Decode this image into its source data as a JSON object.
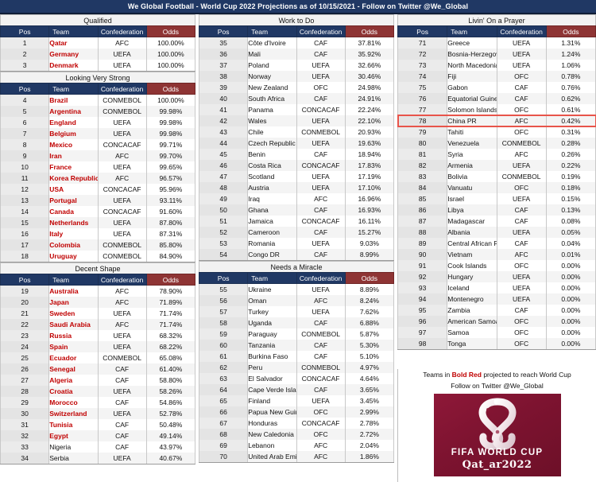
{
  "title": "We Global Football - World Cup 2022 Projections as of 10/15/2021 - Follow on Twitter @We_Global",
  "columns": {
    "pos": "Pos",
    "team": "Team",
    "confederation": "Confederation",
    "odds": "Odds"
  },
  "colors": {
    "header_navy": "#203864",
    "odds_header_red": "#8e3434",
    "qualified_red": "#c00000",
    "highlight": "#e8544a",
    "logo_maroon": "#7d1330"
  },
  "footer": {
    "note_pre": "Teams in ",
    "note_bold": "Bold Red",
    "note_post": " projected to reach World Cup",
    "twitter": "Follow on Twitter @We_Global",
    "logo_line1": "FIFA WORLD CUP",
    "logo_line2": "Qat_ar2022"
  },
  "sections": [
    {
      "name": "Qualified",
      "column": 1,
      "rows": [
        {
          "pos": "1",
          "team": "Qatar",
          "conf": "AFC",
          "odds": "100.00%",
          "qualified": true
        },
        {
          "pos": "2",
          "team": "Germany",
          "conf": "UEFA",
          "odds": "100.00%",
          "qualified": true
        },
        {
          "pos": "3",
          "team": "Denmark",
          "conf": "UEFA",
          "odds": "100.00%",
          "qualified": true
        }
      ]
    },
    {
      "name": "Looking Very Strong",
      "column": 1,
      "rows": [
        {
          "pos": "4",
          "team": "Brazil",
          "conf": "CONMEBOL",
          "odds": "100.00%",
          "qualified": true
        },
        {
          "pos": "5",
          "team": "Argentina",
          "conf": "CONMEBOL",
          "odds": "99.98%",
          "qualified": true
        },
        {
          "pos": "6",
          "team": "England",
          "conf": "UEFA",
          "odds": "99.98%",
          "qualified": true
        },
        {
          "pos": "7",
          "team": "Belgium",
          "conf": "UEFA",
          "odds": "99.98%",
          "qualified": true
        },
        {
          "pos": "8",
          "team": "Mexico",
          "conf": "CONCACAF",
          "odds": "99.71%",
          "qualified": true
        },
        {
          "pos": "9",
          "team": "Iran",
          "conf": "AFC",
          "odds": "99.70%",
          "qualified": true
        },
        {
          "pos": "10",
          "team": "France",
          "conf": "UEFA",
          "odds": "99.65%",
          "qualified": true
        },
        {
          "pos": "11",
          "team": "Korea Republic",
          "conf": "AFC",
          "odds": "96.57%",
          "qualified": true
        },
        {
          "pos": "12",
          "team": "USA",
          "conf": "CONCACAF",
          "odds": "95.96%",
          "qualified": true
        },
        {
          "pos": "13",
          "team": "Portugal",
          "conf": "UEFA",
          "odds": "93.11%",
          "qualified": true
        },
        {
          "pos": "14",
          "team": "Canada",
          "conf": "CONCACAF",
          "odds": "91.60%",
          "qualified": true
        },
        {
          "pos": "15",
          "team": "Netherlands",
          "conf": "UEFA",
          "odds": "87.80%",
          "qualified": true
        },
        {
          "pos": "16",
          "team": "Italy",
          "conf": "UEFA",
          "odds": "87.31%",
          "qualified": true
        },
        {
          "pos": "17",
          "team": "Colombia",
          "conf": "CONMEBOL",
          "odds": "85.80%",
          "qualified": true
        },
        {
          "pos": "18",
          "team": "Uruguay",
          "conf": "CONMEBOL",
          "odds": "84.90%",
          "qualified": true
        }
      ]
    },
    {
      "name": "Decent Shape",
      "column": 1,
      "rows": [
        {
          "pos": "19",
          "team": "Australia",
          "conf": "AFC",
          "odds": "78.90%",
          "qualified": true
        },
        {
          "pos": "20",
          "team": "Japan",
          "conf": "AFC",
          "odds": "71.89%",
          "qualified": true
        },
        {
          "pos": "21",
          "team": "Sweden",
          "conf": "UEFA",
          "odds": "71.74%",
          "qualified": true
        },
        {
          "pos": "22",
          "team": "Saudi Arabia",
          "conf": "AFC",
          "odds": "71.74%",
          "qualified": true
        },
        {
          "pos": "23",
          "team": "Russia",
          "conf": "UEFA",
          "odds": "68.32%",
          "qualified": true
        },
        {
          "pos": "24",
          "team": "Spain",
          "conf": "UEFA",
          "odds": "68.22%",
          "qualified": true
        },
        {
          "pos": "25",
          "team": "Ecuador",
          "conf": "CONMEBOL",
          "odds": "65.08%",
          "qualified": true
        },
        {
          "pos": "26",
          "team": "Senegal",
          "conf": "CAF",
          "odds": "61.40%",
          "qualified": true
        },
        {
          "pos": "27",
          "team": "Algeria",
          "conf": "CAF",
          "odds": "58.80%",
          "qualified": true
        },
        {
          "pos": "28",
          "team": "Croatia",
          "conf": "UEFA",
          "odds": "58.26%",
          "qualified": true
        },
        {
          "pos": "29",
          "team": "Morocco",
          "conf": "CAF",
          "odds": "54.86%",
          "qualified": true
        },
        {
          "pos": "30",
          "team": "Switzerland",
          "conf": "UEFA",
          "odds": "52.78%",
          "qualified": true
        },
        {
          "pos": "31",
          "team": "Tunisia",
          "conf": "CAF",
          "odds": "50.48%",
          "qualified": true
        },
        {
          "pos": "32",
          "team": "Egypt",
          "conf": "CAF",
          "odds": "49.14%",
          "qualified": true
        },
        {
          "pos": "33",
          "team": "Nigeria",
          "conf": "CAF",
          "odds": "43.97%",
          "qualified": false
        },
        {
          "pos": "34",
          "team": "Serbia",
          "conf": "UEFA",
          "odds": "40.67%",
          "qualified": false
        }
      ]
    },
    {
      "name": "Work to Do",
      "column": 2,
      "rows": [
        {
          "pos": "35",
          "team": "Côte d'Ivoire",
          "conf": "CAF",
          "odds": "37.81%",
          "qualified": false
        },
        {
          "pos": "36",
          "team": "Mali",
          "conf": "CAF",
          "odds": "35.92%",
          "qualified": false
        },
        {
          "pos": "37",
          "team": "Poland",
          "conf": "UEFA",
          "odds": "32.66%",
          "qualified": false
        },
        {
          "pos": "38",
          "team": "Norway",
          "conf": "UEFA",
          "odds": "30.46%",
          "qualified": false
        },
        {
          "pos": "39",
          "team": "New Zealand",
          "conf": "OFC",
          "odds": "24.98%",
          "qualified": false
        },
        {
          "pos": "40",
          "team": "South Africa",
          "conf": "CAF",
          "odds": "24.91%",
          "qualified": false
        },
        {
          "pos": "41",
          "team": "Panama",
          "conf": "CONCACAF",
          "odds": "22.24%",
          "qualified": false
        },
        {
          "pos": "42",
          "team": "Wales",
          "conf": "UEFA",
          "odds": "22.10%",
          "qualified": false
        },
        {
          "pos": "43",
          "team": "Chile",
          "conf": "CONMEBOL",
          "odds": "20.93%",
          "qualified": false
        },
        {
          "pos": "44",
          "team": "Czech Republic",
          "conf": "UEFA",
          "odds": "19.63%",
          "qualified": false
        },
        {
          "pos": "45",
          "team": "Benin",
          "conf": "CAF",
          "odds": "18.94%",
          "qualified": false
        },
        {
          "pos": "46",
          "team": "Costa Rica",
          "conf": "CONCACAF",
          "odds": "17.83%",
          "qualified": false
        },
        {
          "pos": "47",
          "team": "Scotland",
          "conf": "UEFA",
          "odds": "17.19%",
          "qualified": false
        },
        {
          "pos": "48",
          "team": "Austria",
          "conf": "UEFA",
          "odds": "17.10%",
          "qualified": false
        },
        {
          "pos": "49",
          "team": "Iraq",
          "conf": "AFC",
          "odds": "16.96%",
          "qualified": false
        },
        {
          "pos": "50",
          "team": "Ghana",
          "conf": "CAF",
          "odds": "16.93%",
          "qualified": false
        },
        {
          "pos": "51",
          "team": "Jamaica",
          "conf": "CONCACAF",
          "odds": "16.11%",
          "qualified": false
        },
        {
          "pos": "52",
          "team": "Cameroon",
          "conf": "CAF",
          "odds": "15.27%",
          "qualified": false
        },
        {
          "pos": "53",
          "team": "Romania",
          "conf": "UEFA",
          "odds": "9.03%",
          "qualified": false
        },
        {
          "pos": "54",
          "team": "Congo DR",
          "conf": "CAF",
          "odds": "8.99%",
          "qualified": false
        }
      ]
    },
    {
      "name": "Needs a Miracle",
      "column": 2,
      "rows": [
        {
          "pos": "55",
          "team": "Ukraine",
          "conf": "UEFA",
          "odds": "8.89%",
          "qualified": false
        },
        {
          "pos": "56",
          "team": "Oman",
          "conf": "AFC",
          "odds": "8.24%",
          "qualified": false
        },
        {
          "pos": "57",
          "team": "Turkey",
          "conf": "UEFA",
          "odds": "7.62%",
          "qualified": false
        },
        {
          "pos": "58",
          "team": "Uganda",
          "conf": "CAF",
          "odds": "6.88%",
          "qualified": false
        },
        {
          "pos": "59",
          "team": "Paraguay",
          "conf": "CONMEBOL",
          "odds": "5.87%",
          "qualified": false
        },
        {
          "pos": "60",
          "team": "Tanzania",
          "conf": "CAF",
          "odds": "5.30%",
          "qualified": false
        },
        {
          "pos": "61",
          "team": "Burkina Faso",
          "conf": "CAF",
          "odds": "5.10%",
          "qualified": false
        },
        {
          "pos": "62",
          "team": "Peru",
          "conf": "CONMEBOL",
          "odds": "4.97%",
          "qualified": false
        },
        {
          "pos": "63",
          "team": "El Salvador",
          "conf": "CONCACAF",
          "odds": "4.64%",
          "qualified": false
        },
        {
          "pos": "64",
          "team": "Cape Verde Islands",
          "conf": "CAF",
          "odds": "3.65%",
          "qualified": false
        },
        {
          "pos": "65",
          "team": "Finland",
          "conf": "UEFA",
          "odds": "3.45%",
          "qualified": false
        },
        {
          "pos": "66",
          "team": "Papua New Guinea",
          "conf": "OFC",
          "odds": "2.99%",
          "qualified": false
        },
        {
          "pos": "67",
          "team": "Honduras",
          "conf": "CONCACAF",
          "odds": "2.78%",
          "qualified": false
        },
        {
          "pos": "68",
          "team": "New Caledonia",
          "conf": "OFC",
          "odds": "2.72%",
          "qualified": false
        },
        {
          "pos": "69",
          "team": "Lebanon",
          "conf": "AFC",
          "odds": "2.04%",
          "qualified": false
        },
        {
          "pos": "70",
          "team": "United Arab Emirates",
          "conf": "AFC",
          "odds": "1.86%",
          "qualified": false
        }
      ]
    },
    {
      "name": "Livin' On a Prayer",
      "column": 3,
      "rows": [
        {
          "pos": "71",
          "team": "Greece",
          "conf": "UEFA",
          "odds": "1.31%",
          "qualified": false
        },
        {
          "pos": "72",
          "team": "Bosnia-Herzegovina",
          "conf": "UEFA",
          "odds": "1.24%",
          "qualified": false
        },
        {
          "pos": "73",
          "team": "North Macedonia",
          "conf": "UEFA",
          "odds": "1.06%",
          "qualified": false
        },
        {
          "pos": "74",
          "team": "Fiji",
          "conf": "OFC",
          "odds": "0.78%",
          "qualified": false
        },
        {
          "pos": "75",
          "team": "Gabon",
          "conf": "CAF",
          "odds": "0.76%",
          "qualified": false
        },
        {
          "pos": "76",
          "team": "Equatorial Guinea",
          "conf": "CAF",
          "odds": "0.62%",
          "qualified": false
        },
        {
          "pos": "77",
          "team": "Solomon Islands",
          "conf": "OFC",
          "odds": "0.61%",
          "qualified": false
        },
        {
          "pos": "78",
          "team": "China PR",
          "conf": "AFC",
          "odds": "0.42%",
          "qualified": false,
          "highlight": true
        },
        {
          "pos": "79",
          "team": "Tahiti",
          "conf": "OFC",
          "odds": "0.31%",
          "qualified": false
        },
        {
          "pos": "80",
          "team": "Venezuela",
          "conf": "CONMEBOL",
          "odds": "0.28%",
          "qualified": false
        },
        {
          "pos": "81",
          "team": "Syria",
          "conf": "AFC",
          "odds": "0.26%",
          "qualified": false
        },
        {
          "pos": "82",
          "team": "Armenia",
          "conf": "UEFA",
          "odds": "0.22%",
          "qualified": false
        },
        {
          "pos": "83",
          "team": "Bolivia",
          "conf": "CONMEBOL",
          "odds": "0.19%",
          "qualified": false
        },
        {
          "pos": "84",
          "team": "Vanuatu",
          "conf": "OFC",
          "odds": "0.18%",
          "qualified": false
        },
        {
          "pos": "85",
          "team": "Israel",
          "conf": "UEFA",
          "odds": "0.15%",
          "qualified": false
        },
        {
          "pos": "86",
          "team": "Libya",
          "conf": "CAF",
          "odds": "0.13%",
          "qualified": false
        },
        {
          "pos": "87",
          "team": "Madagascar",
          "conf": "CAF",
          "odds": "0.08%",
          "qualified": false
        },
        {
          "pos": "88",
          "team": "Albania",
          "conf": "UEFA",
          "odds": "0.05%",
          "qualified": false
        },
        {
          "pos": "89",
          "team": "Central African Republic",
          "conf": "CAF",
          "odds": "0.04%",
          "qualified": false
        },
        {
          "pos": "90",
          "team": "Vietnam",
          "conf": "AFC",
          "odds": "0.01%",
          "qualified": false
        },
        {
          "pos": "91",
          "team": "Cook Islands",
          "conf": "OFC",
          "odds": "0.00%",
          "qualified": false
        },
        {
          "pos": "92",
          "team": "Hungary",
          "conf": "UEFA",
          "odds": "0.00%",
          "qualified": false
        },
        {
          "pos": "93",
          "team": "Iceland",
          "conf": "UEFA",
          "odds": "0.00%",
          "qualified": false
        },
        {
          "pos": "94",
          "team": "Montenegro",
          "conf": "UEFA",
          "odds": "0.00%",
          "qualified": false
        },
        {
          "pos": "95",
          "team": "Zambia",
          "conf": "CAF",
          "odds": "0.00%",
          "qualified": false
        },
        {
          "pos": "96",
          "team": "American Samoa",
          "conf": "OFC",
          "odds": "0.00%",
          "qualified": false
        },
        {
          "pos": "97",
          "team": "Samoa",
          "conf": "OFC",
          "odds": "0.00%",
          "qualified": false
        },
        {
          "pos": "98",
          "team": "Tonga",
          "conf": "OFC",
          "odds": "0.00%",
          "qualified": false
        }
      ]
    }
  ]
}
